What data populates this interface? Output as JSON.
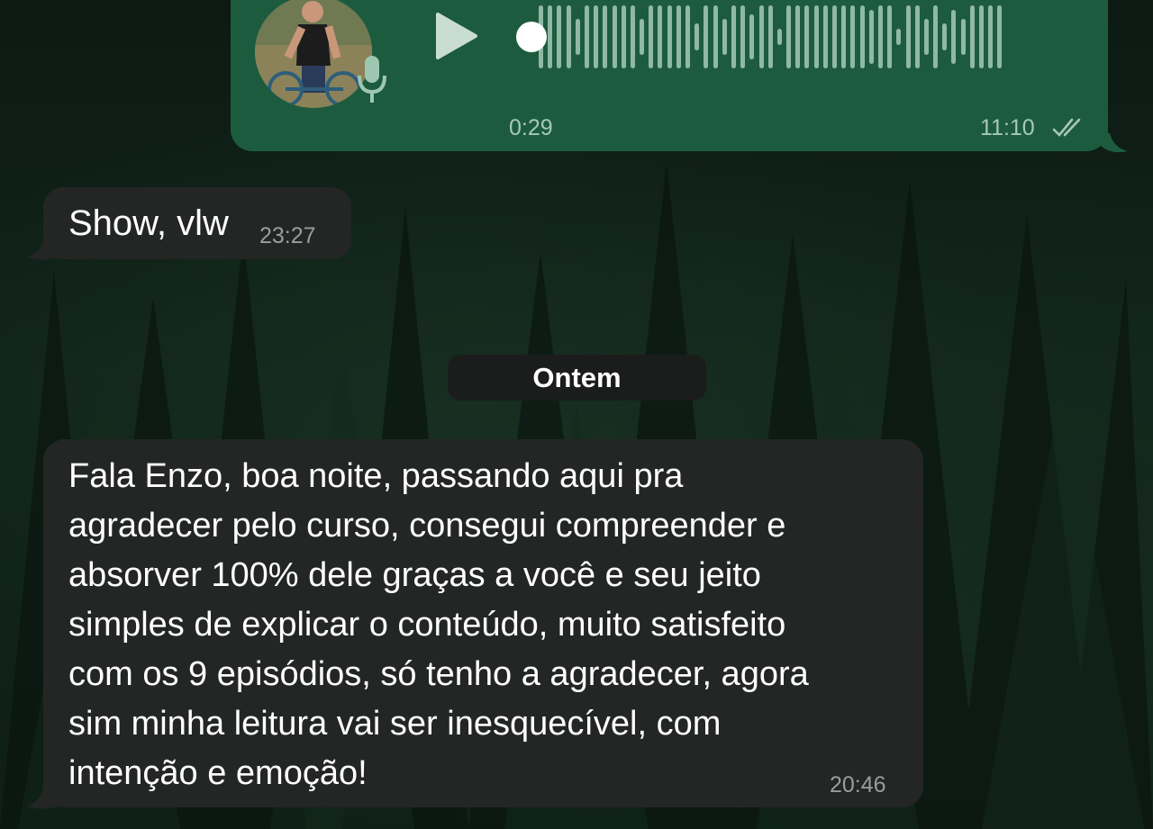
{
  "theme": {
    "outgoing_bubble": "#1d5b3f",
    "incoming_bubble": "#232625",
    "waveform_color": "#8fb9a3"
  },
  "voice_message": {
    "direction": "outgoing",
    "duration": "0:29",
    "time": "11:10",
    "status_icon": "double-check-icon",
    "playback_progress": 0,
    "icons": [
      "play-icon",
      "mic-icon"
    ]
  },
  "messages": [
    {
      "direction": "incoming",
      "text": "Show, vlw",
      "time": "23:27"
    }
  ],
  "date_separator": "Ontem",
  "long_message": {
    "direction": "incoming",
    "lines": [
      "Fala Enzo, boa noite, passando aqui pra",
      "agradecer pelo curso, consegui compreender e",
      "absorver 100% dele graças a você e seu jeito",
      "simples de explicar o conteúdo, muito satisfeito",
      "com os 9 episódios, só tenho a agradecer, agora",
      "sim minha leitura vai ser inesquecível, com",
      "intenção e emoção!"
    ],
    "time": "20:46"
  }
}
